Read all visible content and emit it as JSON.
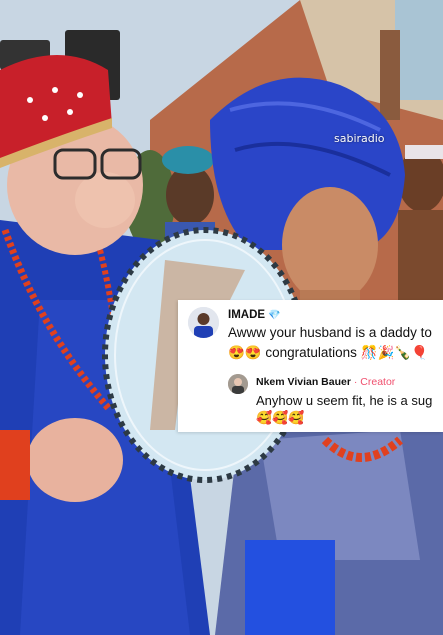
{
  "video": {
    "watermark": "sabiradio"
  },
  "comment": {
    "username": "IMADE",
    "verified_icon": "diamond-icon",
    "text_line1": "Awww your husband is a daddy to",
    "text_line2": "😍😍 congratulations 🎊🎉🍾🎈"
  },
  "reply": {
    "username": "Nkem Vivian Bauer",
    "badge": "· Creator",
    "text": "Anyhow u seem fit, he is a sug",
    "emojis": "🥰🥰🥰"
  },
  "colors": {
    "royal_blue": "#1f3fb5",
    "gele_blue": "#2a45c8",
    "cap_red": "#c8202a",
    "bead_coral": "#e0401e",
    "creator_pink": "#f0506e",
    "verified_blue": "#2aa7e0",
    "fan_blue": "#d3e7f2"
  }
}
